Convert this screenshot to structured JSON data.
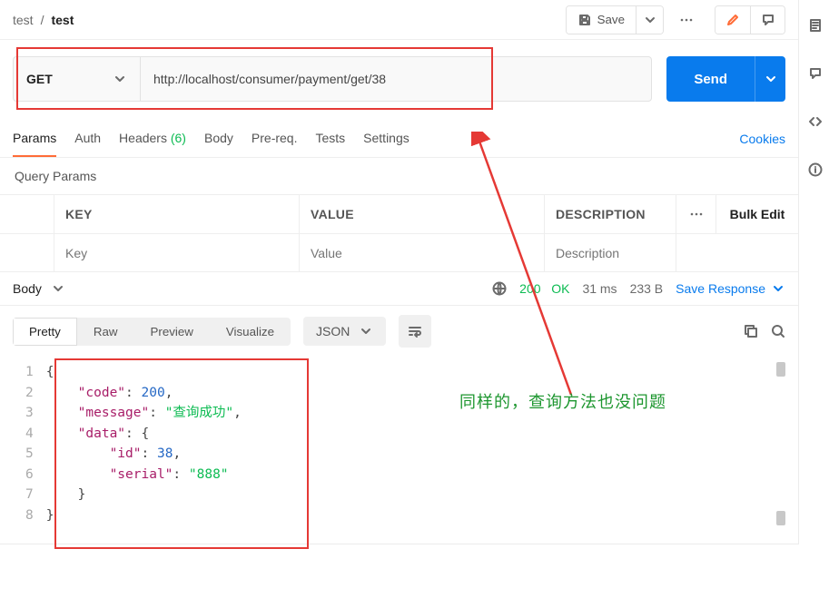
{
  "breadcrumb": {
    "collection": "test",
    "sep": "/",
    "request": "test"
  },
  "header": {
    "save": "Save"
  },
  "request": {
    "method": "GET",
    "url": "http://localhost/consumer/payment/get/38",
    "send": "Send"
  },
  "tabs": {
    "params": "Params",
    "auth": "Auth",
    "headers": "Headers",
    "headers_count": "(6)",
    "body": "Body",
    "prereq": "Pre-req.",
    "tests": "Tests",
    "settings": "Settings",
    "cookies": "Cookies"
  },
  "qp": {
    "title": "Query Params",
    "header": {
      "key": "KEY",
      "value": "VALUE",
      "desc": "DESCRIPTION",
      "bulk": "Bulk Edit"
    },
    "placeholder": {
      "key": "Key",
      "value": "Value",
      "desc": "Description"
    }
  },
  "response": {
    "body": "Body",
    "status": {
      "code": "200",
      "text": "OK"
    },
    "time": "31 ms",
    "size": "233 B",
    "save": "Save Response"
  },
  "view": {
    "pretty": "Pretty",
    "raw": "Raw",
    "preview": "Preview",
    "visualize": "Visualize",
    "format": "JSON"
  },
  "code": {
    "lines": [
      "1",
      "2",
      "3",
      "4",
      "5",
      "6",
      "7",
      "8"
    ],
    "l2_key": "\"code\"",
    "l2_val": "200",
    "l3_key": "\"message\"",
    "l3_val": "\"查询成功\"",
    "l4_key": "\"data\"",
    "l5_key": "\"id\"",
    "l5_val": "38",
    "l6_key": "\"serial\"",
    "l6_val": "\"888\""
  },
  "annotation": "同样的，查询方法也没问题"
}
